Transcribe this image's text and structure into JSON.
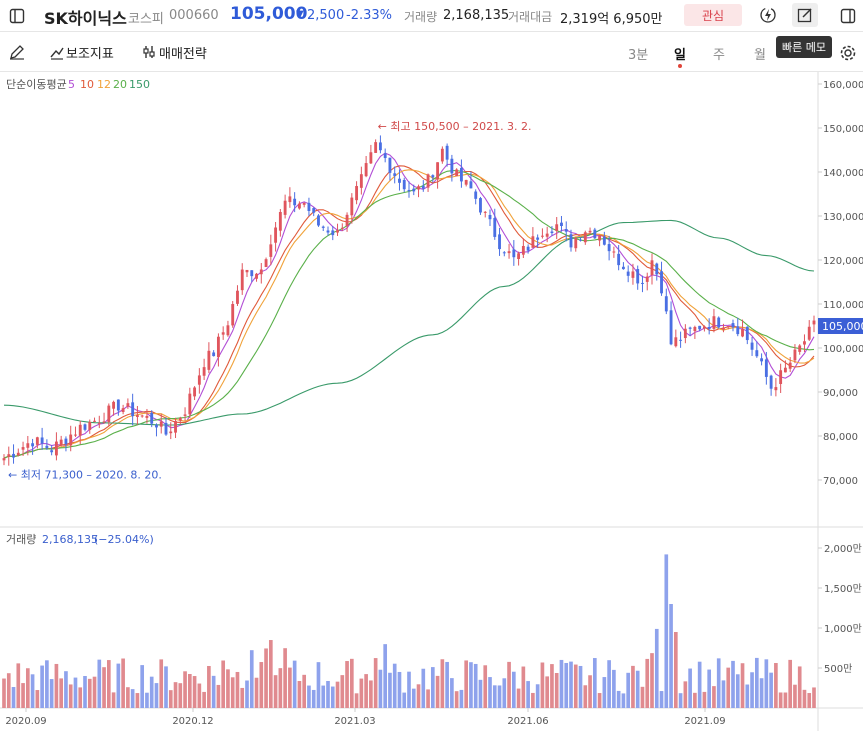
{
  "header": {
    "stock_name": "SK하이닉스",
    "market": "코스피",
    "code": "000660",
    "price": "105,000",
    "change_arrow": "▼",
    "change": "2,500",
    "change_pct": "-2.33%",
    "volume_label": "거래량",
    "volume": "2,168,135",
    "amount_label": "거래대금",
    "amount": "2,319억 6,950만",
    "watch_label": "관심"
  },
  "toolbar": {
    "indicators_label": "보조지표",
    "strategy_label": "매매전략",
    "periods": [
      "3분",
      "일",
      "주",
      "월"
    ],
    "active_period": "일",
    "memo_tooltip": "빠른 메모"
  },
  "colors": {
    "up": "#e0555d",
    "down": "#4a6fe3",
    "ma5": "#b24fd6",
    "ma10": "#e05a3a",
    "ma12": "#f0a23a",
    "ma20": "#5ab04a",
    "ma150": "#3a9a6a"
  },
  "chart_data": {
    "type": "candlestick",
    "legend": {
      "title": "단순이동평균",
      "periods": [
        "5",
        "10",
        "12",
        "20",
        "150"
      ]
    },
    "y_axis_ticks": [
      "160,000",
      "150,000",
      "140,000",
      "130,000",
      "120,000",
      "110,000",
      "100,000",
      "90,000",
      "80,000",
      "70,000"
    ],
    "ylim": [
      60000,
      163000
    ],
    "current_price_label": "105,000",
    "annotations": {
      "high": "← 최고 150,500 – 2021. 3. 2.",
      "low": "← 최저 71,300 – 2020. 8. 20."
    },
    "x_ticks": [
      "2020.09",
      "2020.12",
      "2021.03",
      "2021.06",
      "2021.09"
    ],
    "price_path": [
      [
        0,
        75000
      ],
      [
        6,
        79000
      ],
      [
        10,
        77000
      ],
      [
        16,
        82000
      ],
      [
        20,
        84000
      ],
      [
        24,
        87000
      ],
      [
        28,
        85000
      ],
      [
        32,
        83000
      ],
      [
        34,
        80500
      ],
      [
        38,
        86000
      ],
      [
        42,
        97000
      ],
      [
        44,
        99000
      ],
      [
        47,
        106000
      ],
      [
        50,
        117000
      ],
      [
        54,
        118000
      ],
      [
        56,
        125000
      ],
      [
        59,
        133000
      ],
      [
        63,
        133000
      ],
      [
        66,
        128000
      ],
      [
        70,
        126000
      ],
      [
        72,
        131000
      ],
      [
        75,
        138000
      ],
      [
        78,
        146000
      ],
      [
        80,
        143000
      ],
      [
        83,
        138000
      ],
      [
        86,
        135000
      ],
      [
        89,
        138000
      ],
      [
        92,
        145000
      ],
      [
        95,
        139000
      ],
      [
        98,
        136000
      ],
      [
        101,
        130000
      ],
      [
        104,
        124000
      ],
      [
        107,
        120000
      ],
      [
        110,
        123000
      ],
      [
        113,
        127000
      ],
      [
        116,
        128000
      ],
      [
        119,
        124000
      ],
      [
        122,
        127000
      ],
      [
        125,
        126000
      ],
      [
        128,
        121000
      ],
      [
        131,
        118000
      ],
      [
        134,
        115000
      ],
      [
        136,
        120000
      ],
      [
        138,
        114000
      ],
      [
        140,
        101000
      ],
      [
        143,
        103000
      ],
      [
        146,
        105000
      ],
      [
        149,
        106000
      ],
      [
        152,
        106000
      ],
      [
        155,
        104000
      ],
      [
        158,
        98000
      ],
      [
        161,
        91000
      ],
      [
        164,
        95000
      ],
      [
        167,
        100000
      ],
      [
        170,
        105000
      ]
    ],
    "volume": {
      "label": "거래량",
      "value": "2,168,135",
      "change": "(−25.04%)",
      "axis_ticks": [
        "2,000만",
        "1,500만",
        "1,000만",
        "500만"
      ],
      "ylim": [
        0,
        2000
      ],
      "unit": "만"
    }
  }
}
